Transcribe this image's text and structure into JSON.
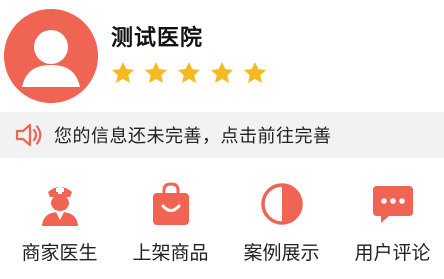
{
  "profile": {
    "name": "测试医院",
    "rating": 5,
    "avatar_icon": "user-avatar-icon"
  },
  "notice": {
    "icon": "speaker-icon",
    "text": "您的信息还未完善，点击前往完善"
  },
  "menu": [
    {
      "label": "商家医生",
      "icon": "doctor-icon"
    },
    {
      "label": "上架商品",
      "icon": "shopping-bag-icon"
    },
    {
      "label": "案例展示",
      "icon": "half-circle-icon"
    },
    {
      "label": "用户评论",
      "icon": "comment-bubble-icon"
    }
  ],
  "colors": {
    "accent": "#ef6452",
    "star": "#f5b921",
    "notice_bg": "#f2f2f2"
  }
}
